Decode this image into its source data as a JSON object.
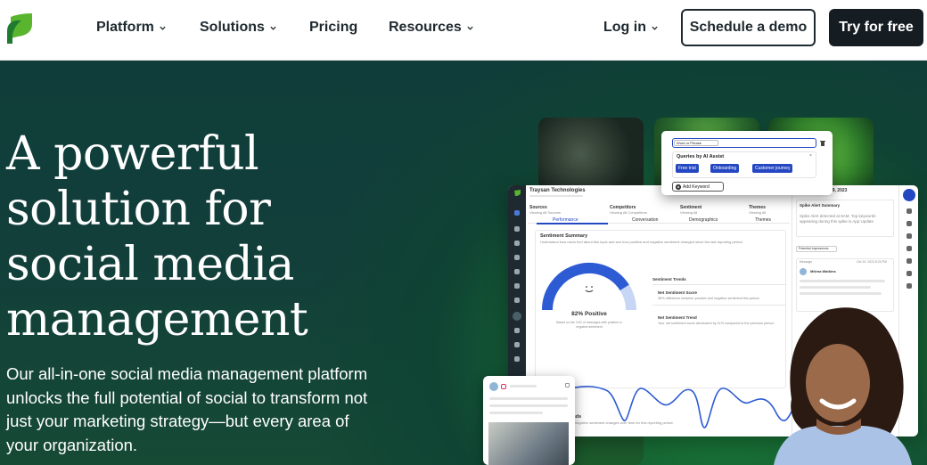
{
  "nav": {
    "platform": "Platform",
    "solutions": "Solutions",
    "pricing": "Pricing",
    "resources": "Resources",
    "login": "Log in",
    "demo": "Schedule a demo",
    "trial": "Try for free"
  },
  "hero": {
    "title": "A powerful solution for social media management",
    "text": "Our all-in-one social media management platform unlocks the full potential of social to transform not just your marketing strategy—but every area of your organization."
  },
  "dashboard": {
    "company": "Traysan Technologies",
    "date": "Friday, October 19, 2023",
    "filters": [
      "Sources",
      "Competitors",
      "Sentiment",
      "Themes"
    ],
    "filter_values": [
      "Viewing All Sources",
      "Viewing All Competitors",
      "Viewing All",
      "Viewing All"
    ],
    "tabs": [
      "Performance",
      "Conversation",
      "Demographics",
      "Themes"
    ],
    "sentiment_summary": "Sentiment Summary",
    "sentiment_summary_desc": "Understand how users feel about this topic and see how positive and negative sentiment changed since the last reporting period.",
    "gauge_value": "82% Positive",
    "gauge_percent": 82,
    "gauge_caption": "Based on the 10% of messages with positive or negative sentiment",
    "sentiment_trends_label": "Sentiment Trends",
    "net_score_label": "Net Sentiment Score",
    "net_score_text": "38% difference between positive and negative sentiment this period.",
    "net_trend_label": "Net Sentiment Trend",
    "net_trend_text": "Your net sentiment score decreased by 11% compared to the previous period.",
    "trends_title": "Sentiment Trends",
    "trends_desc": "View the positive and negative sentiment changes over time for this reporting period.",
    "spike_title": "Spike Alert Summary",
    "spike_text": "Spike Alert detected at 8AM. Top keywords appearing during this spike is App Update",
    "potential": "Potential Impressions",
    "message_label": "Message",
    "message_date": "Oct 19, 2023 8:23 PM",
    "author": "Milena Watkins"
  },
  "queries": {
    "select": "Word or Phrase",
    "title": "Queries by AI Assist",
    "chips": [
      "Free trial",
      "Onboarding",
      "Customer journey"
    ],
    "add": "Add Keyword"
  },
  "colors": {
    "brand_green": "#59b42e",
    "nav_text": "#1f2a30",
    "hero_bg": "#0f3d39",
    "chip_blue": "#2548c2",
    "gauge_blue": "#2d5bd3"
  }
}
